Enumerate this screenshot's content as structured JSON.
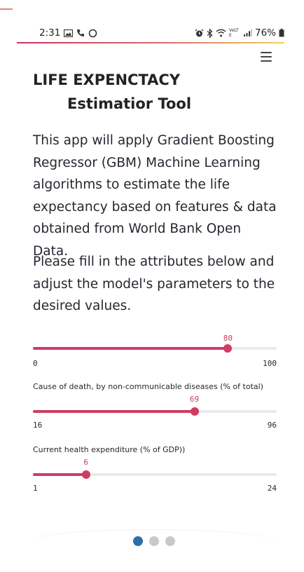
{
  "status_bar": {
    "time": "2:31",
    "left_icons": [
      "image-icon",
      "phone-icon",
      "circle-icon"
    ],
    "right_icons": [
      "alarm-icon",
      "bluetooth-icon",
      "wifi-icon",
      "volte-icon",
      "signal-icon"
    ],
    "network_label": "VoLTE",
    "battery": "76%"
  },
  "header": {
    "menu_icon": "hamburger-menu-icon"
  },
  "title": {
    "line1": "LIFE EXPENCTACY",
    "line2": "Estimatior Tool"
  },
  "intro": {
    "paragraph1": "This app will apply Gradient Boosting Regressor (GBM) Machine Learning algorithms to estimate the life expectancy based on features & data obtained from World Bank Open Data.",
    "paragraph2": "Please fill in the attributes below and adjust the model's parameters to the desired values."
  },
  "sliders": [
    {
      "label": "",
      "value": "80",
      "min": "0",
      "max": "100"
    },
    {
      "label": "Cause of death, by non-communicable diseases (% of total)",
      "value": "69",
      "min": "16",
      "max": "96"
    },
    {
      "label": "Current health expenditure (% of GDP))",
      "value": "6",
      "min": "1",
      "max": "24"
    }
  ],
  "pager": {
    "count": 3,
    "active": 0
  },
  "colors": {
    "accent": "#cf3d63",
    "track": "#e9e9ee",
    "pager_active": "#2f6fa6",
    "pager_inactive": "#c9c9c9",
    "text": "#262730"
  }
}
